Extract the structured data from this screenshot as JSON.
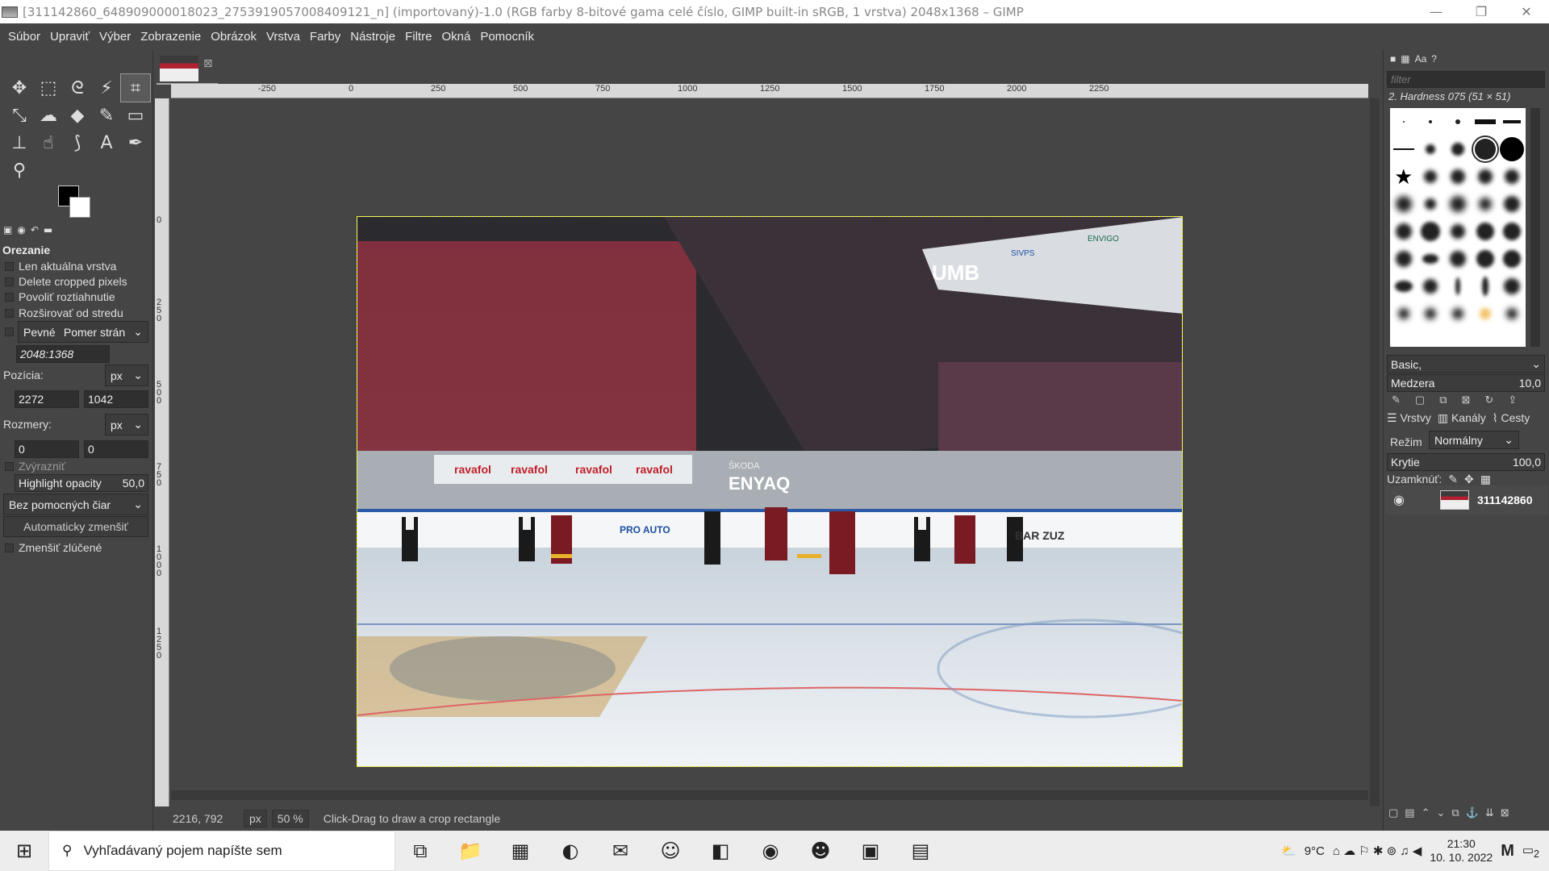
{
  "window": {
    "title": "[311142860_648909000018023_2753919057008409121_n] (importovaný)-1.0 (RGB farby 8-bitové gama celé číslo, GIMP built-in sRGB, 1 vrstva) 2048x1368 – GIMP",
    "minimize": "—",
    "maximize": "❐",
    "close": "✕"
  },
  "menu": [
    "Súbor",
    "Upraviť",
    "Výber",
    "Zobrazenie",
    "Obrázok",
    "Vrstva",
    "Farby",
    "Nástroje",
    "Filtre",
    "Okná",
    "Pomocník"
  ],
  "toolbox": {
    "tools": [
      {
        "name": "move-tool-icon",
        "glyph": "✥"
      },
      {
        "name": "rect-select-icon",
        "glyph": "⬚"
      },
      {
        "name": "lasso-icon",
        "glyph": "ᘓ"
      },
      {
        "name": "fuzzy-select-icon",
        "glyph": "⚡"
      },
      {
        "name": "crop-tool-icon",
        "glyph": "⌗"
      },
      {
        "name": "transform-tool-icon",
        "glyph": "⤡"
      },
      {
        "name": "warp-tool-icon",
        "glyph": "☁"
      },
      {
        "name": "bucket-fill-icon",
        "glyph": "◆"
      },
      {
        "name": "paintbrush-icon",
        "glyph": "✎"
      },
      {
        "name": "eraser-icon",
        "glyph": "▭"
      },
      {
        "name": "clone-tool-icon",
        "glyph": "⊥"
      },
      {
        "name": "smudge-tool-icon",
        "glyph": "☝"
      },
      {
        "name": "paths-tool-icon",
        "glyph": "⟆"
      },
      {
        "name": "text-tool-icon",
        "glyph": "A"
      },
      {
        "name": "color-picker-icon",
        "glyph": "✒"
      },
      {
        "name": "zoom-tool-icon",
        "glyph": "⚲"
      }
    ],
    "options_title": "Orezanie",
    "current_layer_only": "Len aktuálna vrstva",
    "delete_cropped": "Delete cropped pixels",
    "allow_growing": "Povoliť roztiahnutie",
    "expand_center": "Rozširovať od stredu",
    "fixed_label": "Pevné",
    "fixed_mode": "Pomer strán",
    "ratio_value": "2048:1368",
    "position_label": "Pozícia:",
    "position_unit": "px",
    "pos_x": "2272",
    "pos_y": "1042",
    "size_label": "Rozmery:",
    "size_unit": "px",
    "size_w": "0",
    "size_h": "0",
    "highlight_label": "Zvýrazniť",
    "highlight_opacity_label": "Highlight opacity",
    "highlight_opacity_value": "50,0",
    "guides": "Bez pomocných čiar",
    "auto_shrink": "Automaticky zmenšiť",
    "shrink_merged": "Zmenšiť zlúčené"
  },
  "canvas": {
    "ruler_top": [
      "-250",
      "0",
      "250",
      "500",
      "750",
      "1000",
      "1250",
      "1500",
      "1750",
      "2000",
      "2250"
    ],
    "ruler_left": [
      "0",
      "250",
      "500",
      "750",
      "1000",
      "1250"
    ],
    "status_coords": "2216, 792",
    "status_unit": "px",
    "zoom": "50 %",
    "status_message": "Click-Drag to draw a crop rectangle"
  },
  "photo": {
    "ads": [
      "ravafol",
      "ravafol",
      "ravafol",
      "ravafol",
      "ŠKODA",
      "ENYAQ",
      "PRO AUTO",
      "BAR ZUZ",
      "UMB",
      "ENVIGO",
      "SIVPS"
    ]
  },
  "dock": {
    "filter_placeholder": "filter",
    "brush_name": "2. Hardness 075 (51 × 51)",
    "brush_set": "Basic,",
    "spacing_label": "Medzera",
    "spacing_value": "10,0",
    "tabs": [
      "Vrstvy",
      "Kanály",
      "Cesty"
    ],
    "mode_label": "Režim",
    "mode_value": "Normálny",
    "opacity_label": "Krytie",
    "opacity_value": "100,0",
    "lock_label": "Uzamknúť:",
    "layer_name": "311142860"
  },
  "taskbar": {
    "search_placeholder": "Vyhľadávaný pojem napíšte sem",
    "weather": "9°C",
    "time": "21:30",
    "date": "10. 10. 2022",
    "notifications": "2",
    "apps": [
      {
        "name": "task-view-icon",
        "glyph": "⧉"
      },
      {
        "name": "file-explorer-icon",
        "glyph": "📁"
      },
      {
        "name": "store-icon",
        "glyph": "▦"
      },
      {
        "name": "edge-icon",
        "glyph": "◐"
      },
      {
        "name": "mail-icon",
        "glyph": "✉"
      },
      {
        "name": "chat-icon",
        "glyph": "☺"
      },
      {
        "name": "office-icon",
        "glyph": "◧"
      },
      {
        "name": "spotify-icon",
        "glyph": "◉"
      },
      {
        "name": "discord-icon",
        "glyph": "☻"
      },
      {
        "name": "gimp-icon",
        "glyph": "▣"
      },
      {
        "name": "image-viewer-icon",
        "glyph": "▤"
      }
    ]
  }
}
